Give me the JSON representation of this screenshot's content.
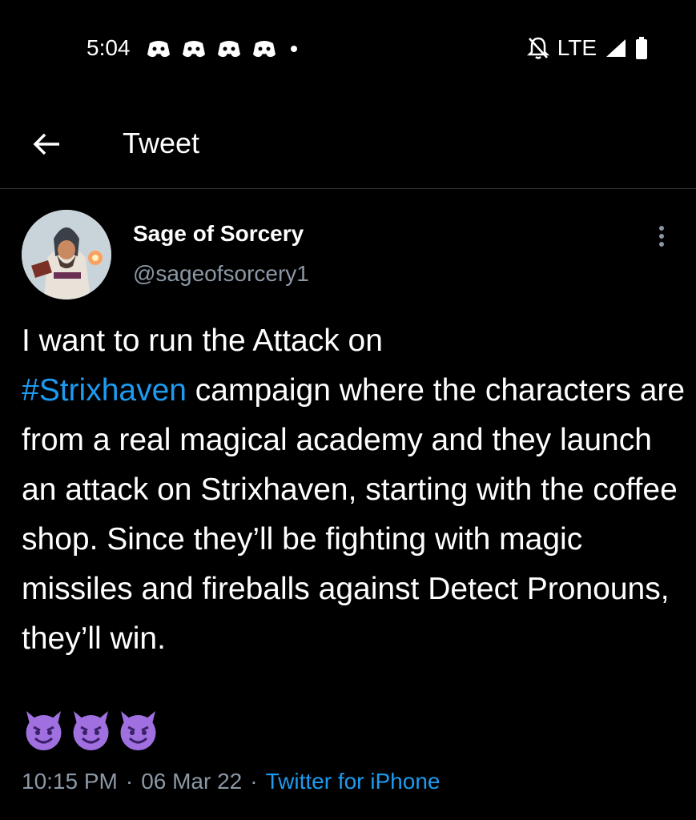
{
  "status_bar": {
    "time": "5:04",
    "notifications": [
      "discord-icon",
      "discord-icon",
      "discord-icon",
      "discord-icon"
    ],
    "network": "LTE",
    "icons": [
      "mute-bell-icon",
      "signal-icon",
      "battery-icon"
    ]
  },
  "header": {
    "title": "Tweet",
    "back_icon": "back-arrow-icon"
  },
  "tweet": {
    "author_name": "Sage of Sorcery",
    "author_handle": "@sageofsorcery1",
    "text_before": "I want to run the Attack on\n",
    "hashtag": "#Strixhaven",
    "text_after": " campaign where the characters are from a real magical academy and they launch an attack on Strixhaven, starting with the coffee shop. Since they’ll be fighting with magic missiles and fireballs against Detect Pronouns, they’ll win.",
    "emojis": [
      "smiling-devil-emoji",
      "smiling-devil-emoji",
      "smiling-devil-emoji"
    ],
    "time": "10:15 PM",
    "sep1": "·",
    "date": "06 Mar 22",
    "sep2": "·",
    "source": "Twitter for iPhone"
  },
  "colors": {
    "background": "#000000",
    "link": "#1d9bf0",
    "muted": "#8b98a5",
    "emoji": "#a070e0"
  }
}
